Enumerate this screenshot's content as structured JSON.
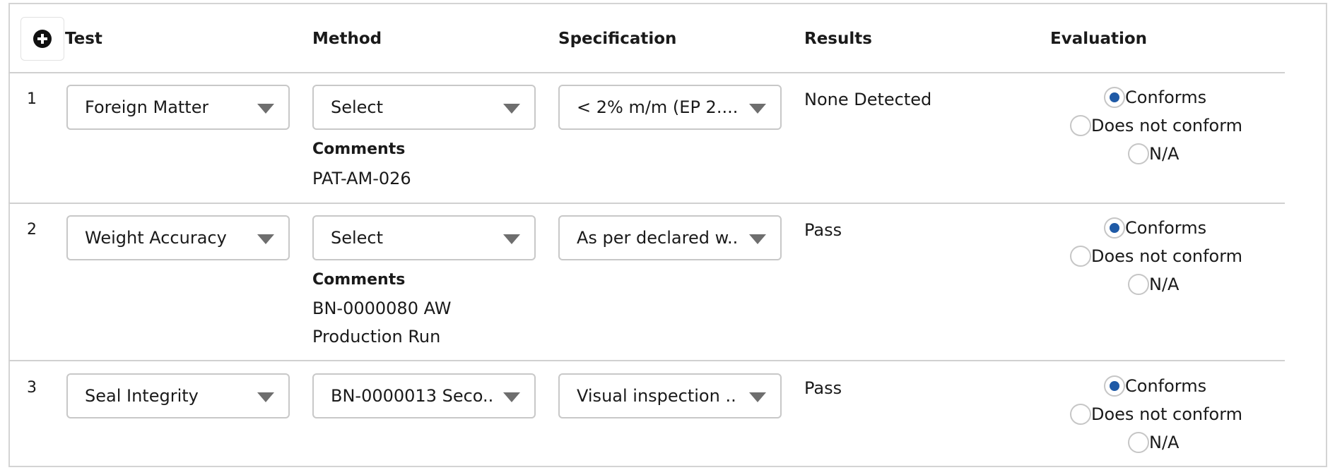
{
  "header": {
    "test": "Test",
    "method": "Method",
    "specification": "Specification",
    "results": "Results",
    "evaluation": "Evaluation",
    "add_icon": "plus-circle-icon"
  },
  "rows": [
    {
      "number": "1",
      "test": "Foreign Matter",
      "method": "Select",
      "specification": "< 2% m/m (EP 2....",
      "comments_label": "Comments",
      "comments": [
        "PAT-AM-026"
      ],
      "result": "None Detected",
      "evaluation": {
        "options": [
          "Conforms",
          "Does not conform",
          "N/A"
        ],
        "selected": "Conforms"
      }
    },
    {
      "number": "2",
      "test": "Weight Accuracy",
      "method": "Select",
      "specification": "As per declared w...",
      "comments_label": "Comments",
      "comments": [
        "BN-0000080 AW",
        "Production Run"
      ],
      "result": "Pass",
      "evaluation": {
        "options": [
          "Conforms",
          "Does not conform",
          "N/A"
        ],
        "selected": "Conforms"
      }
    },
    {
      "number": "3",
      "test": "Seal Integrity",
      "method": "BN-0000013 Seco...",
      "specification": "Visual inspection ...",
      "result": "Pass",
      "evaluation": {
        "options": [
          "Conforms",
          "Does not conform",
          "N/A"
        ],
        "selected": "Conforms"
      }
    }
  ],
  "colors": {
    "radio_selected": "#1f5aa6",
    "border": "#c8c8c8"
  }
}
